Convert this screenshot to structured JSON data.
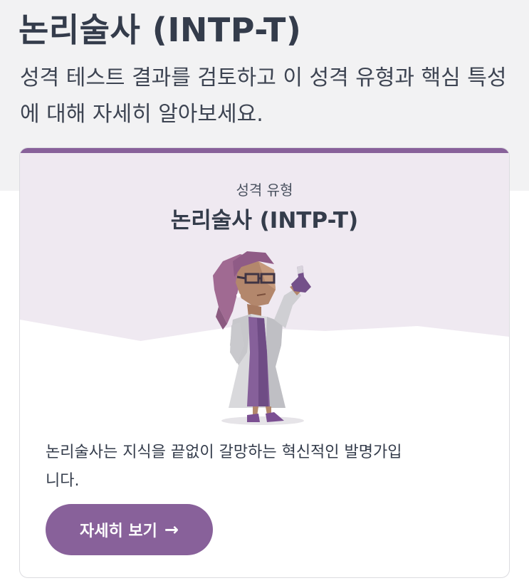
{
  "header": {
    "title": "논리술사 (INTP-T)",
    "subtitle": "성격 테스트 결과를 검토하고 이 성격 유형과 핵심 특성에 대해 자세히 알아보세요."
  },
  "card": {
    "label": "성격 유형",
    "title": "논리술사 (INTP-T)",
    "description": "논리술사는 지식을 끝없이 갈망하는 혁신적인 발명가입니다.",
    "button_label": "자세히 보기",
    "button_icon": "arrow-right-icon",
    "accent_color": "#88619a"
  }
}
